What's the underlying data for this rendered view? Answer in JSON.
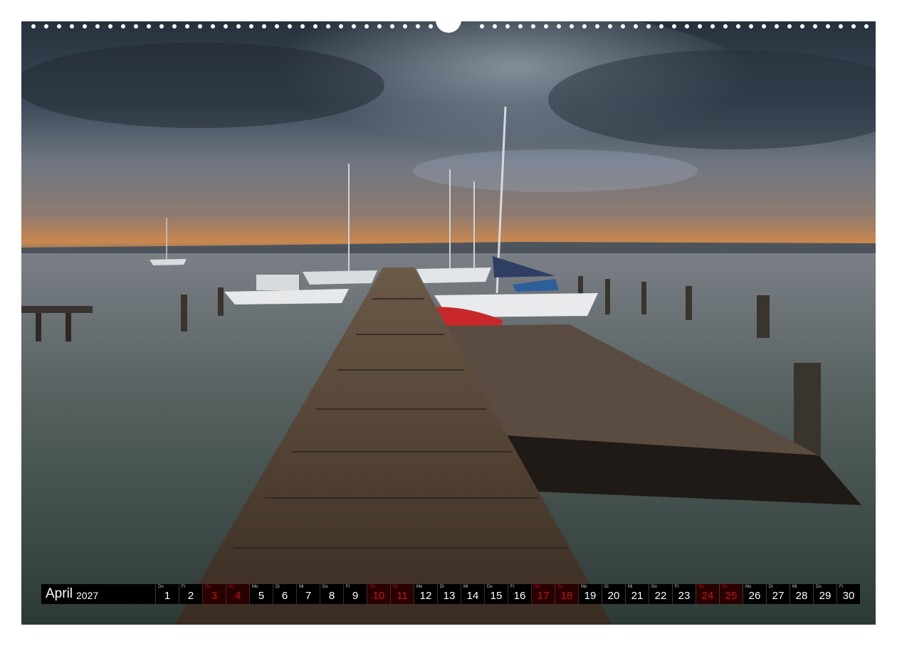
{
  "calendar": {
    "month": "April",
    "year": "2027",
    "days": [
      {
        "wd": "Do",
        "n": "1",
        "h": false
      },
      {
        "wd": "Fr",
        "n": "2",
        "h": false
      },
      {
        "wd": "Sa",
        "n": "3",
        "h": true
      },
      {
        "wd": "So",
        "n": "4",
        "h": true
      },
      {
        "wd": "Mo",
        "n": "5",
        "h": false
      },
      {
        "wd": "Di",
        "n": "6",
        "h": false
      },
      {
        "wd": "Mi",
        "n": "7",
        "h": false
      },
      {
        "wd": "Do",
        "n": "8",
        "h": false
      },
      {
        "wd": "Fr",
        "n": "9",
        "h": false
      },
      {
        "wd": "Sa",
        "n": "10",
        "h": true
      },
      {
        "wd": "So",
        "n": "11",
        "h": true
      },
      {
        "wd": "Mo",
        "n": "12",
        "h": false
      },
      {
        "wd": "Di",
        "n": "13",
        "h": false
      },
      {
        "wd": "Mi",
        "n": "14",
        "h": false
      },
      {
        "wd": "Do",
        "n": "15",
        "h": false
      },
      {
        "wd": "Fr",
        "n": "16",
        "h": false
      },
      {
        "wd": "Sa",
        "n": "17",
        "h": true
      },
      {
        "wd": "So",
        "n": "18",
        "h": true
      },
      {
        "wd": "Mo",
        "n": "19",
        "h": false
      },
      {
        "wd": "Di",
        "n": "20",
        "h": false
      },
      {
        "wd": "Mi",
        "n": "21",
        "h": false
      },
      {
        "wd": "Do",
        "n": "22",
        "h": false
      },
      {
        "wd": "Fr",
        "n": "23",
        "h": false
      },
      {
        "wd": "Sa",
        "n": "24",
        "h": true
      },
      {
        "wd": "So",
        "n": "25",
        "h": true
      },
      {
        "wd": "Mo",
        "n": "26",
        "h": false
      },
      {
        "wd": "Di",
        "n": "27",
        "h": false
      },
      {
        "wd": "Mi",
        "n": "28",
        "h": false
      },
      {
        "wd": "Do",
        "n": "29",
        "h": false
      },
      {
        "wd": "Fr",
        "n": "30",
        "h": false
      }
    ]
  },
  "colors": {
    "weekday_text": "#ffffff",
    "weekend_text": "#c0141a",
    "bar_background": "#000000"
  }
}
